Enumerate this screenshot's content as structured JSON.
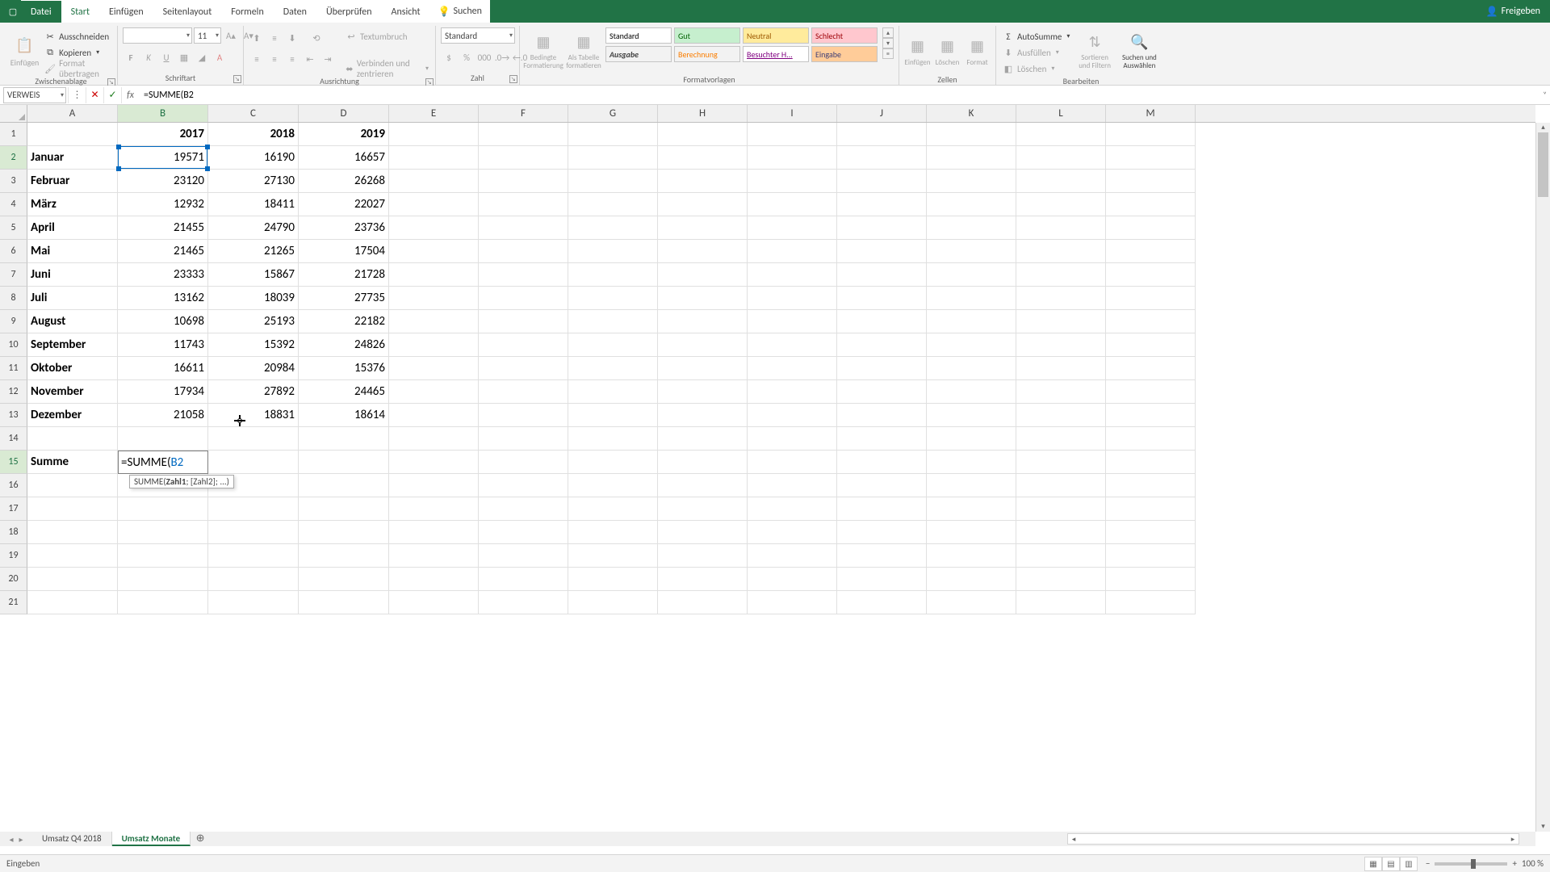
{
  "titlebar": {
    "share": "Freigeben"
  },
  "tabs": {
    "file": "Datei",
    "list": [
      "Start",
      "Einfügen",
      "Seitenlayout",
      "Formeln",
      "Daten",
      "Überprüfen",
      "Ansicht"
    ],
    "active": "Start",
    "search": "Suchen"
  },
  "ribbon": {
    "clipboard": {
      "label": "Zwischenablage",
      "paste": "Einfügen",
      "cut": "Ausschneiden",
      "copy": "Kopieren",
      "formatpainter": "Format übertragen"
    },
    "font": {
      "label": "Schriftart",
      "name": "",
      "size": "11"
    },
    "align": {
      "label": "Ausrichtung",
      "wrap": "Textumbruch",
      "merge": "Verbinden und zentrieren"
    },
    "number": {
      "label": "Zahl",
      "format": "Standard"
    },
    "stylesgrp": {
      "label": "Formatvorlagen",
      "condfmt": "Bedingte Formatierung",
      "astable": "Als Tabelle formatieren",
      "cells": [
        "Standard",
        "Gut",
        "Neutral",
        "Schlecht",
        "Ausgabe",
        "Berechnung",
        "Besuchter H...",
        "Eingabe"
      ]
    },
    "cells": {
      "label": "Zellen",
      "insert": "Einfügen",
      "delete": "Löschen",
      "format": "Format"
    },
    "editing": {
      "label": "Bearbeiten",
      "autosum": "AutoSumme",
      "fill": "Ausfüllen",
      "clear": "Löschen",
      "sort": "Sortieren und Filtern",
      "find": "Suchen und Auswählen"
    }
  },
  "formulabar": {
    "namebox": "VERWEIS",
    "formula": "=SUMME(B2"
  },
  "columns": [
    "A",
    "B",
    "C",
    "D",
    "E",
    "F",
    "G",
    "H",
    "I",
    "J",
    "K",
    "L",
    "M"
  ],
  "rows": 21,
  "headers": {
    "B": "2017",
    "C": "2018",
    "D": "2019"
  },
  "months": [
    "Januar",
    "Februar",
    "März",
    "April",
    "Mai",
    "Juni",
    "Juli",
    "August",
    "September",
    "Oktober",
    "November",
    "Dezember"
  ],
  "sumlabel": "Summe",
  "data": {
    "B": [
      19571,
      23120,
      12932,
      21455,
      21465,
      23333,
      13162,
      10698,
      11743,
      16611,
      17934,
      21058
    ],
    "C": [
      16190,
      27130,
      18411,
      24790,
      21265,
      15867,
      18039,
      25193,
      15392,
      20984,
      27892,
      18831
    ],
    "D": [
      16657,
      26268,
      22027,
      23736,
      17504,
      21728,
      27735,
      22182,
      24826,
      15376,
      24465,
      18614
    ]
  },
  "editcell": {
    "prefix": "=SUMME(",
    "ref": "B2"
  },
  "tooltip": {
    "fn": "SUMME(",
    "arg1": "Zahl1",
    "rest": "; [Zahl2]; ...)"
  },
  "worksheets": {
    "tabs": [
      "Umsatz Q4 2018",
      "Umsatz Monate"
    ],
    "active": 1
  },
  "status": {
    "mode": "Eingeben",
    "zoom": "100 %"
  }
}
